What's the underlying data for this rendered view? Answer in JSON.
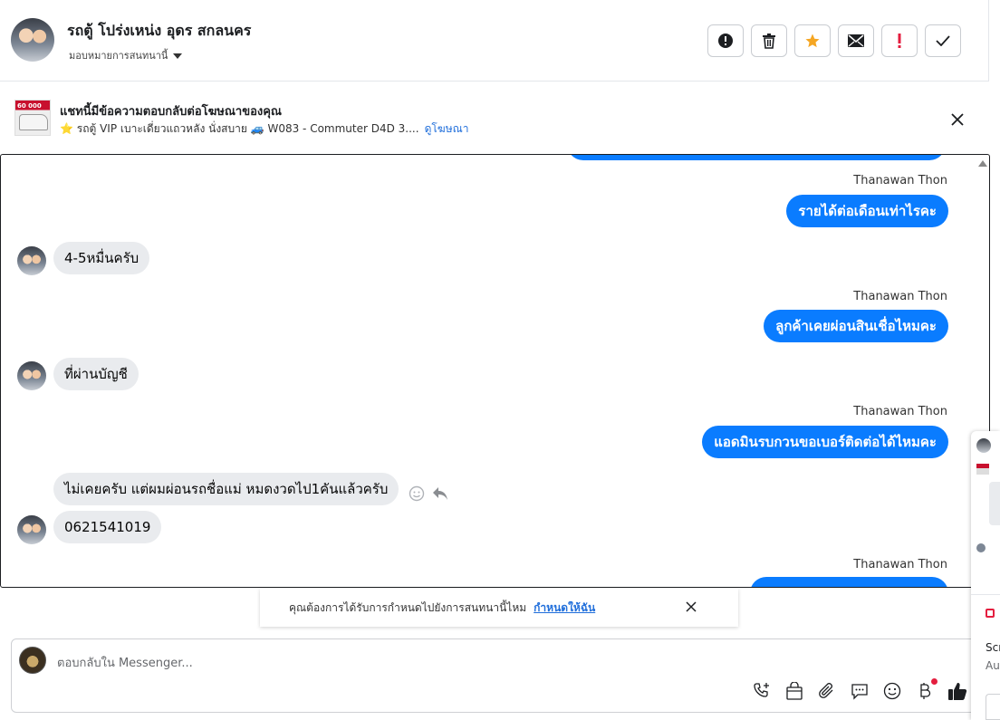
{
  "header": {
    "contact_name": "รถตู้ โปร่งเหน่ง อุดร สกลนคร",
    "assign_label": "มอบหมายการสนทนานี้",
    "actions": [
      {
        "name": "report-spam-button",
        "icon": "exclamation-circle-icon"
      },
      {
        "name": "delete-button",
        "icon": "trash-icon"
      },
      {
        "name": "star-button",
        "icon": "star-icon",
        "color": "#f5a623"
      },
      {
        "name": "mark-unread-button",
        "icon": "envelope-icon"
      },
      {
        "name": "follow-up-button",
        "icon": "exclamation-icon",
        "color": "#e41e3f"
      },
      {
        "name": "mark-done-button",
        "icon": "check-icon"
      }
    ]
  },
  "ad": {
    "title": "แชทนี้มีข้อความตอบกลับต่อโฆษณาของคุณ",
    "subtitle": "⭐ รถตู้ VIP เบาะเดี่ยวแถวหลัง นั่งสบาย 🚙 W083 - Commuter D4D 3....",
    "link": "ดูโฆษณา",
    "thumb_price": "60 000"
  },
  "messages": {
    "s1": "Thanawan Thon",
    "o1": "รายได้ต่อเดือนเท่าไรคะ",
    "i1": "4-5หมื่นครับ",
    "s2": "Thanawan Thon",
    "o2": "ลูกค้าเคยผ่อนสินเชื่อไหมคะ",
    "i2": "ที่ผ่านบัญชี",
    "s3": "Thanawan Thon",
    "o3": "แอดมินรบกวนขอเบอร์ติดต่อได้ไหมคะ",
    "i3": "ไม่เคยครับ แต่ผมผ่อนรถชื่อแม่ หมดงวดไป1คันแล้วครับ",
    "i4": "0621541019",
    "s4": "Thanawan Thon"
  },
  "reminder": {
    "text": "คุณต้องการได้รับการกำหนดไปยังการสนทนานี้ไหม",
    "link": "กำหนดให้ฉัน"
  },
  "composer": {
    "placeholder": "ตอบกลับใน Messenger..."
  },
  "right_panel": {
    "line1": "Scr",
    "line2": "Au"
  },
  "colors": {
    "outgoing_bubble": "#0a7cff",
    "incoming_bubble": "#e9ebee",
    "link": "#216fdb"
  }
}
